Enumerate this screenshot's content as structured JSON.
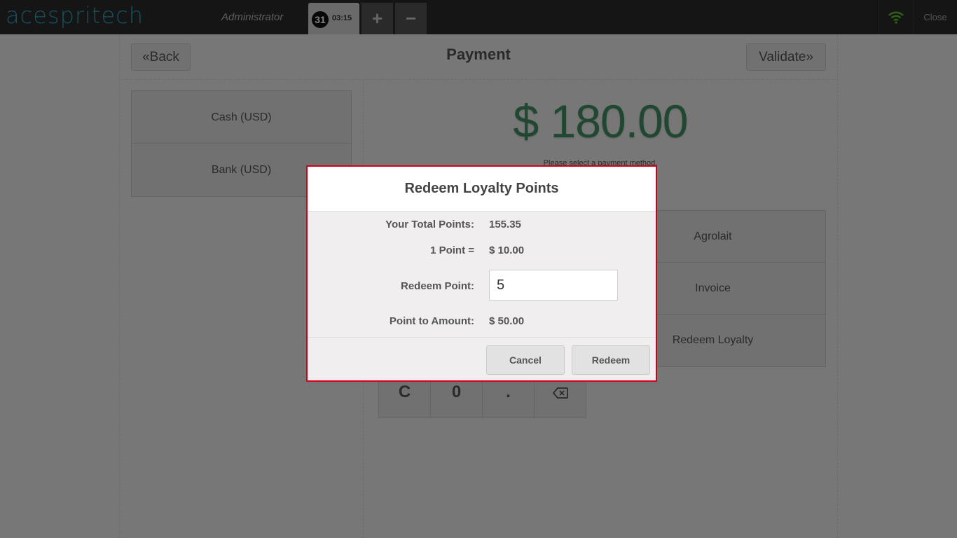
{
  "topbar": {
    "logo": "acespritech",
    "user": "Administrator",
    "order_number": "31",
    "order_time": "03:15",
    "add_symbol": "+",
    "remove_symbol": "−",
    "close_label": "Close"
  },
  "payment": {
    "title": "Payment",
    "back_label": "Back",
    "validate_label": "Validate",
    "total": "$ 180.00",
    "hint": "Please select a payment method.",
    "methods": [
      "Cash (USD)",
      "Bank (USD)"
    ],
    "options": [
      "Agrolait",
      "Invoice",
      "Redeem Loyalty"
    ],
    "numpad_bottom": [
      "C",
      "0",
      "."
    ]
  },
  "modal": {
    "title": "Redeem Loyalty Points",
    "total_points_label": "Your Total Points:",
    "total_points_value": "155.35",
    "point_rate_label": "1 Point =",
    "point_rate_value": "$ 10.00",
    "redeem_label": "Redeem Point:",
    "redeem_value": "5",
    "amount_label": "Point to Amount:",
    "amount_value": "$ 50.00",
    "cancel_label": "Cancel",
    "redeem_button_label": "Redeem"
  },
  "colors": {
    "topbar": "#2a2a2a",
    "logo": "#2aa6c7",
    "total_text": "#3f8f63",
    "wifi": "#5cc12d",
    "modal_border": "#d0021b"
  },
  "icons": {
    "wifi": "wifi-icon",
    "back": "double-chevron-left-icon",
    "validate": "double-chevron-right-icon",
    "backspace": "backspace-icon"
  }
}
